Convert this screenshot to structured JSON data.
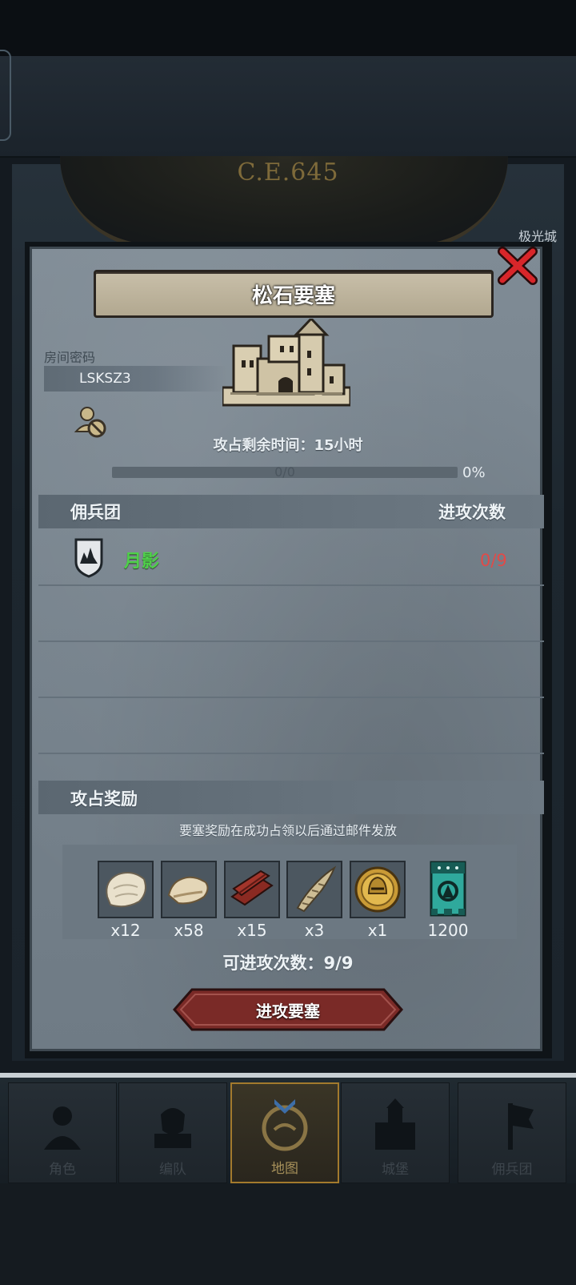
{
  "map": {
    "era": "C.E.645",
    "corner_label": "极光城"
  },
  "dialog": {
    "title": "松石要塞",
    "room_code_label": "房间密码",
    "room_code": "LSKSZ3",
    "time_remaining": "攻占剩余时间：15小时",
    "progress_text": "0/0",
    "progress_percent_text": "0%",
    "progress": 0,
    "mercenary_header": "佣兵团",
    "attacks_header": "进攻次数",
    "guilds": [
      {
        "name": "月影",
        "count": "0/9",
        "icon": "shield-crest-icon"
      }
    ],
    "reward_header": "攻占奖励",
    "reward_notice": "要塞奖励在成功占领以后通过邮件发放",
    "rewards": [
      {
        "icon": "white-fur-icon",
        "qty": "x12"
      },
      {
        "icon": "hide-icon",
        "qty": "x58"
      },
      {
        "icon": "wood-planks-icon",
        "qty": "x15"
      },
      {
        "icon": "horn-icon",
        "qty": "x3"
      },
      {
        "icon": "gold-helmet-coin-icon",
        "qty": "x1"
      },
      {
        "icon": "guild-banner-icon",
        "qty": "1200"
      }
    ],
    "available_attempts": "可进攻次数：9/9",
    "attack_button": "进攻要塞"
  },
  "nav": {
    "items": [
      {
        "label": "角色",
        "icon": "character-icon",
        "active": false
      },
      {
        "label": "编队",
        "icon": "formation-icon",
        "active": false
      },
      {
        "label": "地图",
        "icon": "map-icon",
        "active": true
      },
      {
        "label": "城堡",
        "icon": "castle-icon",
        "active": false
      },
      {
        "label": "佣兵团",
        "icon": "mercenary-icon",
        "active": false
      }
    ]
  },
  "colors": {
    "guild_name": "#4fd04a",
    "guild_count": "#e24a48",
    "close_x": "#d8262a",
    "attack_button": "#7a2a27"
  }
}
